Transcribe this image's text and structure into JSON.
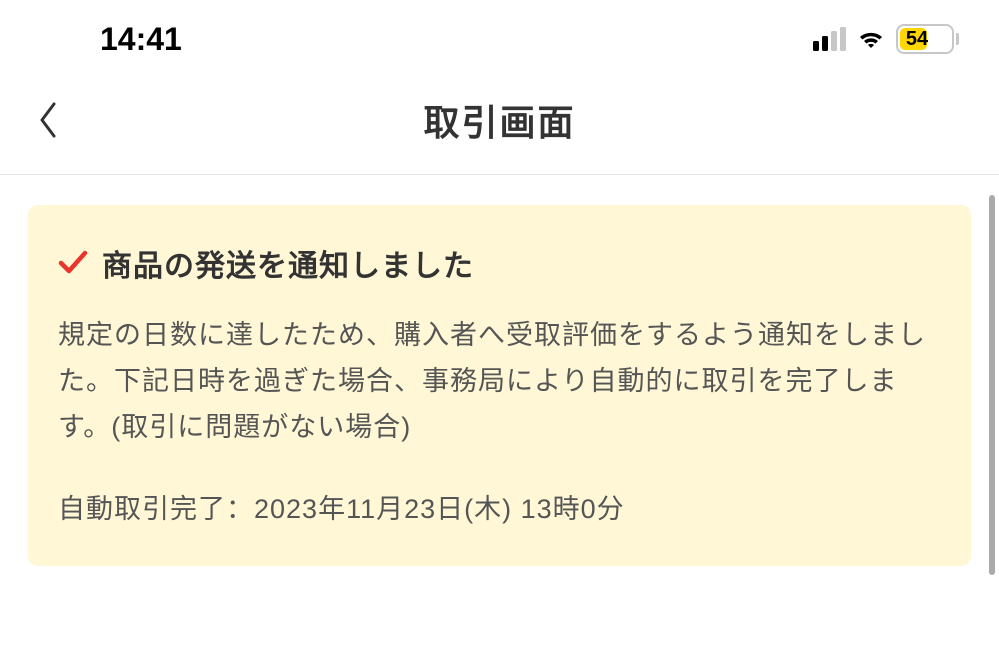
{
  "status_bar": {
    "time": "14:41",
    "battery_level": "54"
  },
  "header": {
    "title": "取引画面"
  },
  "notification": {
    "title": "商品の発送を通知しました",
    "body": "規定の日数に達したため、購入者へ受取評価をするよう通知をしました。下記日時を過ぎた場合、事務局により自動的に取引を完了します。(取引に問題がない場合)",
    "completion_label": "自動取引完了：",
    "completion_date": "2023年11月23日(木) 13時0分"
  }
}
